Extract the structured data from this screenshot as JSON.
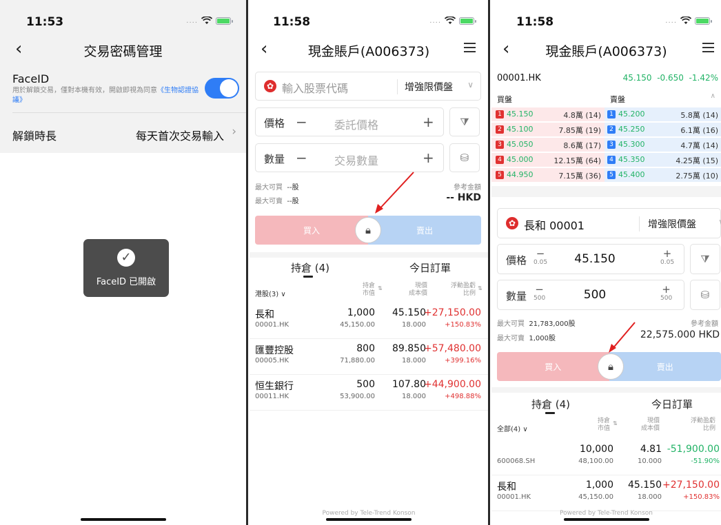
{
  "colors": {
    "accent": "#2f7df6",
    "buy": "#f5b8bc",
    "sell": "#b7d3f4",
    "up": "#e03131",
    "down": "#22b366"
  },
  "panel1": {
    "time": "11:53",
    "title": "交易密碼管理",
    "faceid_title": "FaceID",
    "faceid_desc": "用於解鎖交易，僅對本機有效，開啟即視為同意",
    "faceid_link": "《生物認證協議》",
    "faceid_enabled": true,
    "unlock_label": "解鎖時長",
    "unlock_value": "每天首次交易輸入",
    "toast": "FaceID 已開啟"
  },
  "panel2": {
    "time": "11:58",
    "title": "現金賬戶(A006373)",
    "stock_placeholder": "輸入股票代碼",
    "order_type": "增強限價盤",
    "price_label": "價格",
    "price_placeholder": "委託價格",
    "qty_label": "數量",
    "qty_placeholder": "交易數量",
    "max_buy_label": "最大可買",
    "max_buy": "--股",
    "max_sell_label": "最大可賣",
    "max_sell": "--股",
    "ref_label": "參考金額",
    "ref_value": "-- HKD",
    "buy": "買入",
    "sell": "賣出",
    "tab_positions": "持倉 (4)",
    "tab_orders": "今日訂單",
    "filter": "港股(3)",
    "col_qty": "持倉",
    "col_mv": "市值",
    "col_price": "現價",
    "col_cost": "成本價",
    "col_pl": "浮動盈虧",
    "col_ratio": "比例",
    "rows": [
      {
        "name": "長和",
        "code": "00001.HK",
        "qty": "1,000",
        "mv": "45,150.00",
        "price": "45.150",
        "cost": "18.000",
        "pl": "+27,150.00",
        "ratio": "+150.83%"
      },
      {
        "name": "匯豐控股",
        "code": "00005.HK",
        "qty": "800",
        "mv": "71,880.00",
        "price": "89.850",
        "cost": "18.000",
        "pl": "+57,480.00",
        "ratio": "+399.16%"
      },
      {
        "name": "恒生銀行",
        "code": "00011.HK",
        "qty": "500",
        "mv": "53,900.00",
        "price": "107.80",
        "cost": "18.000",
        "pl": "+44,900.00",
        "ratio": "+498.88%"
      }
    ],
    "footer": "Powered by Tele-Trend Konson"
  },
  "panel3": {
    "time": "11:58",
    "title": "現金賬戶(A006373)",
    "quote_code": "00001.HK",
    "quote_price": "45.150",
    "quote_chg": "-0.650",
    "quote_pct": "-1.42%",
    "bid_label": "買盤",
    "ask_label": "賣盤",
    "book": [
      {
        "n": "1",
        "bid": "45.150",
        "bidv": "4.8萬 (14)",
        "ask": "45.200",
        "askv": "5.8萬 (14)"
      },
      {
        "n": "2",
        "bid": "45.100",
        "bidv": "7.85萬 (19)",
        "ask": "45.250",
        "askv": "6.1萬 (16)"
      },
      {
        "n": "3",
        "bid": "45.050",
        "bidv": "8.6萬 (17)",
        "ask": "45.300",
        "askv": "4.7萬 (14)"
      },
      {
        "n": "4",
        "bid": "45.000",
        "bidv": "12.15萬 (64)",
        "ask": "45.350",
        "askv": "4.25萬 (15)"
      },
      {
        "n": "5",
        "bid": "44.950",
        "bidv": "7.15萬 (36)",
        "ask": "45.400",
        "askv": "2.75萬 (10)"
      }
    ],
    "stock": "長和 00001",
    "order_type": "增強限價盤",
    "price_label": "價格",
    "price": "45.150",
    "step": "0.05",
    "qty_label": "數量",
    "qty": "500",
    "qty_step": "500",
    "max_buy_label": "最大可買",
    "max_buy": "21,783,000股",
    "max_sell_label": "最大可賣",
    "max_sell": "1,000股",
    "ref_label": "參考金額",
    "ref_value": "22,575.000 HKD",
    "buy": "買入",
    "sell": "賣出",
    "tab_positions": "持倉 (4)",
    "tab_orders": "今日訂單",
    "filter": "全部(4)",
    "col_qty": "持倉",
    "col_mv": "市值",
    "col_price": "現價",
    "col_cost": "成本價",
    "col_pl": "浮動盈虧",
    "col_ratio": "比例",
    "rows": [
      {
        "name": "",
        "code": "600068.SH",
        "qty": "10,000",
        "mv": "48,100.00",
        "price": "4.81",
        "cost": "10.000",
        "pl": "-51,900.00",
        "ratio": "-51.90%"
      },
      {
        "name": "長和",
        "code": "00001.HK",
        "qty": "1,000",
        "mv": "45,150.00",
        "price": "45.150",
        "cost": "18.000",
        "pl": "+27,150.00",
        "ratio": "+150.83%"
      }
    ],
    "footer": "Powered by Tele-Trend Konson"
  }
}
